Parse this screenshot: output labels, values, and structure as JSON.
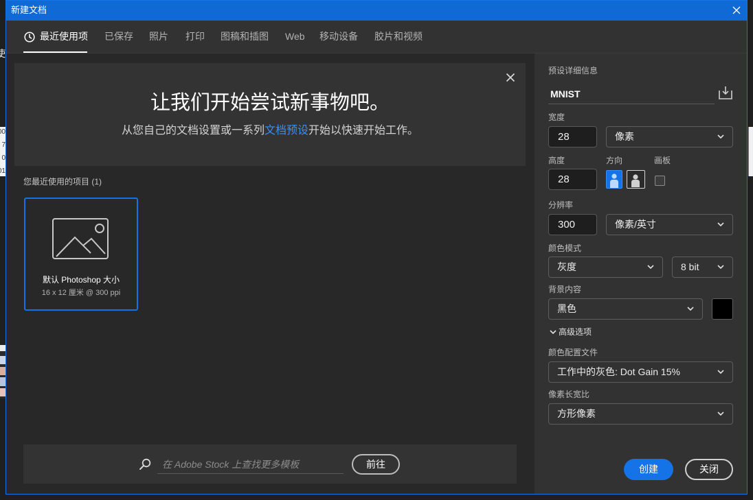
{
  "window": {
    "title": "新建文档"
  },
  "tabs": [
    {
      "label": "最近使用项",
      "active": true
    },
    {
      "label": "已保存",
      "active": false
    },
    {
      "label": "照片",
      "active": false
    },
    {
      "label": "打印",
      "active": false
    },
    {
      "label": "图稿和插图",
      "active": false
    },
    {
      "label": "Web",
      "active": false
    },
    {
      "label": "移动设备",
      "active": false
    },
    {
      "label": "胶片和视频",
      "active": false
    }
  ],
  "hero": {
    "title": "让我们开始尝试新事物吧。",
    "subtitle_before": "从您自己的文档设置或一系列",
    "subtitle_link": "文档预设",
    "subtitle_after": "开始以快速开始工作。"
  },
  "recent": {
    "heading": "您最近使用的项目 (1)",
    "items": [
      {
        "name": "默认 Photoshop 大小",
        "details": "16 x 12 厘米 @ 300 ppi",
        "selected": true
      }
    ]
  },
  "stock": {
    "placeholder": "在 Adobe Stock 上查找更多模板",
    "go_label": "前往"
  },
  "preset": {
    "heading": "预设详细信息",
    "name": "MNIST",
    "width": {
      "label": "宽度",
      "value": "28",
      "unit": "像素"
    },
    "height": {
      "label": "高度",
      "value": "28"
    },
    "orientation": {
      "label": "方向",
      "portrait_selected": true
    },
    "artboard": {
      "label": "画板",
      "checked": false
    },
    "resolution": {
      "label": "分辨率",
      "value": "300",
      "unit": "像素/英寸"
    },
    "color_mode": {
      "label": "颜色模式",
      "mode": "灰度",
      "depth": "8 bit"
    },
    "background": {
      "label": "背景内容",
      "value": "黑色"
    },
    "advanced": {
      "label": "高级选项",
      "expanded": true
    },
    "color_profile": {
      "label": "颜色配置文件",
      "value": "工作中的灰色: Dot Gain 15%"
    },
    "pixel_aspect": {
      "label": "像素长宽比",
      "value": "方形像素"
    }
  },
  "actions": {
    "create_label": "创建",
    "close_label": "关闭"
  },
  "colors": {
    "accent": "#1473e6",
    "title_bar": "#0f6ad6",
    "link": "#3b8ff0",
    "background_swatch": "#000000"
  },
  "icons": {
    "dialog_close": "close-icon",
    "recent_tab": "clock-icon",
    "hero_close": "close-icon",
    "recent_thumbnail": "image-placeholder-icon",
    "stock_search": "search-icon",
    "save_preset": "save-preset-icon",
    "dropdown": "chevron-down-icon",
    "portrait": "portrait-orientation-icon",
    "landscape": "landscape-orientation-icon"
  },
  "background_windows": {
    "fragments": [
      "使",
      "00",
      "7",
      "0",
      "01"
    ]
  }
}
